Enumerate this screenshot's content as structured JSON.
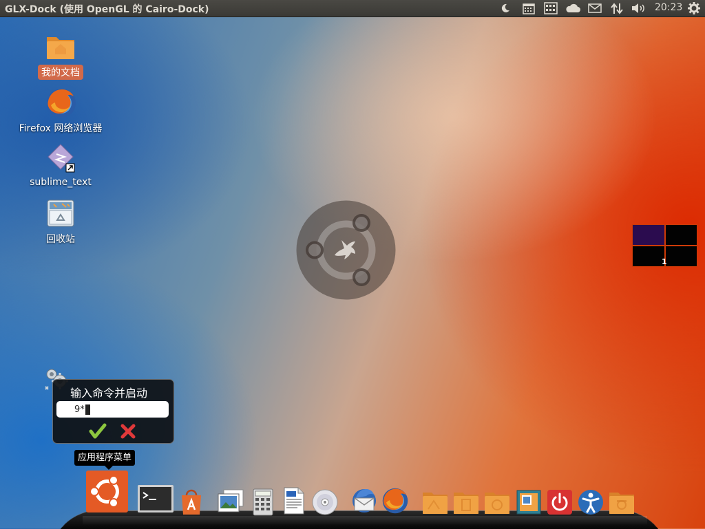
{
  "top_panel": {
    "title": "GLX-Dock (使用 OpenGL 的 Cairo-Dock)",
    "clock": "20:23",
    "tray_icons": [
      "moon-icon",
      "calendar-icon",
      "keyboard-icon",
      "cloud-icon",
      "mail-icon",
      "network-arrows-icon",
      "volume-icon",
      "settings-gear-icon"
    ]
  },
  "desktop": {
    "icons": [
      {
        "label": "我的文档",
        "icon": "home-folder-icon",
        "selected": true
      },
      {
        "label": "Firefox 网络浏览器",
        "icon": "firefox-icon"
      },
      {
        "label": "sublime_text",
        "icon": "sublime-text-icon"
      },
      {
        "label": "回收站",
        "icon": "trash-icon"
      }
    ]
  },
  "workspace_switcher": {
    "current_label": "1"
  },
  "run_dialog": {
    "title": "输入命令并启动",
    "input_value": "9*"
  },
  "tooltip": {
    "text": "应用程序菜单"
  },
  "dock": {
    "items": [
      {
        "name": "applications-menu"
      },
      {
        "name": "terminal"
      },
      {
        "name": "software-center"
      },
      {
        "name": "image-viewer"
      },
      {
        "name": "calculator"
      },
      {
        "name": "text-document"
      },
      {
        "name": "cd-drive"
      },
      {
        "name": "thunderbird"
      },
      {
        "name": "firefox"
      },
      {
        "name": "folder"
      },
      {
        "name": "documents-folder"
      },
      {
        "name": "music-folder"
      },
      {
        "name": "pictures-folder"
      },
      {
        "name": "shutdown"
      },
      {
        "name": "accessibility"
      },
      {
        "name": "camera-folder"
      }
    ]
  },
  "colors": {
    "panel": "#3c3b37",
    "accent_orange": "#e95420",
    "selection": "#d26a4a"
  }
}
